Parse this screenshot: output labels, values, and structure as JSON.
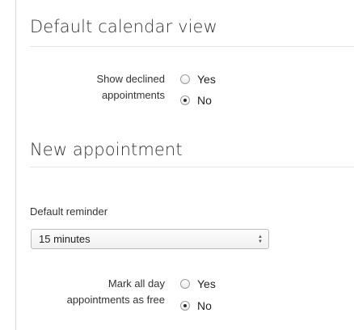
{
  "sections": {
    "calendar_view": {
      "title": "Default calendar view",
      "show_declined": {
        "label_line1": "Show declined",
        "label_line2": "appointments",
        "options": [
          "Yes",
          "No"
        ],
        "selected": "No"
      }
    },
    "new_appointment": {
      "title": "New appointment",
      "default_reminder": {
        "label": "Default reminder",
        "value": "15 minutes"
      },
      "mark_all_day": {
        "label_line1": "Mark all day",
        "label_line2": "appointments as free",
        "options": [
          "Yes",
          "No"
        ],
        "selected": "No"
      }
    }
  },
  "icons": {
    "select_arrows": "updown-chevron-icon"
  }
}
